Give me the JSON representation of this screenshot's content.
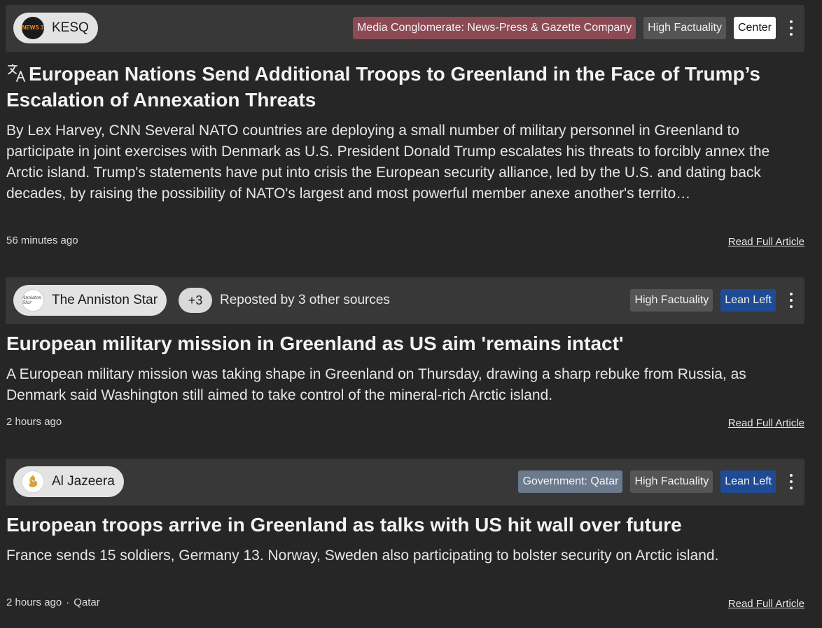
{
  "articles": [
    {
      "source": {
        "name": "KESQ",
        "logo_text": "NEWS 3"
      },
      "tags": {
        "owner": "Media Conglomerate: News-Press & Gazette Company",
        "factuality": "High Factuality",
        "bias": "Center"
      },
      "title": "European Nations Send Additional Troops to Greenland in the Face of Trump’s Escalation of Annexation Threats",
      "summary": "By Lex Harvey, CNN Several NATO countries are deploying a small number of military personnel in Greenland to participate in joint exercises with Denmark as U.S. President Donald Trump escalates his threats to forcibly annex the Arctic island. Trump's statements have put into crisis the European security alliance, led by the U.S. and dating back decades, by raising the possibility of NATO's largest and most powerful member anexe another's territo…",
      "time": "56 minutes ago",
      "read_link": "Read Full Article",
      "translated": true
    },
    {
      "source": {
        "name": "The Anniston Star",
        "logo_text": "Anniston Star"
      },
      "repost": {
        "count": "+3",
        "text": "Reposted by 3 other sources"
      },
      "tags": {
        "factuality": "High Factuality",
        "bias": "Lean Left"
      },
      "title": "European military mission in Greenland as US aim 'remains intact'",
      "summary": "A European military mission was taking shape in Greenland on Thursday, drawing a sharp rebuke from Russia, as Denmark said Washington still aimed to take control of the mineral-rich Arctic island.",
      "time": "2 hours ago",
      "read_link": "Read Full Article"
    },
    {
      "source": {
        "name": "Al Jazeera",
        "logo_text": "الجزيرة"
      },
      "tags": {
        "owner": "Government: Qatar",
        "factuality": "High Factuality",
        "bias": "Lean Left"
      },
      "title": "European troops arrive in Greenland as talks with US hit wall over future",
      "summary": "France sends 15 soldiers, Germany 13. Norway, Sweden also participating to bolster security on Arctic island.",
      "time": "2 hours ago",
      "location": "Qatar",
      "read_link": "Read Full Article"
    }
  ],
  "colors": {
    "background": "#262626",
    "header_bar": "#383838",
    "owner_tag": "#8c4a55",
    "government_tag": "#6b7a8c",
    "factuality_tag": "#555555",
    "center_tag": "#ffffff",
    "lean_left_tag": "#1f4b94"
  },
  "icons": [
    "translate-icon",
    "more-options-icon"
  ]
}
